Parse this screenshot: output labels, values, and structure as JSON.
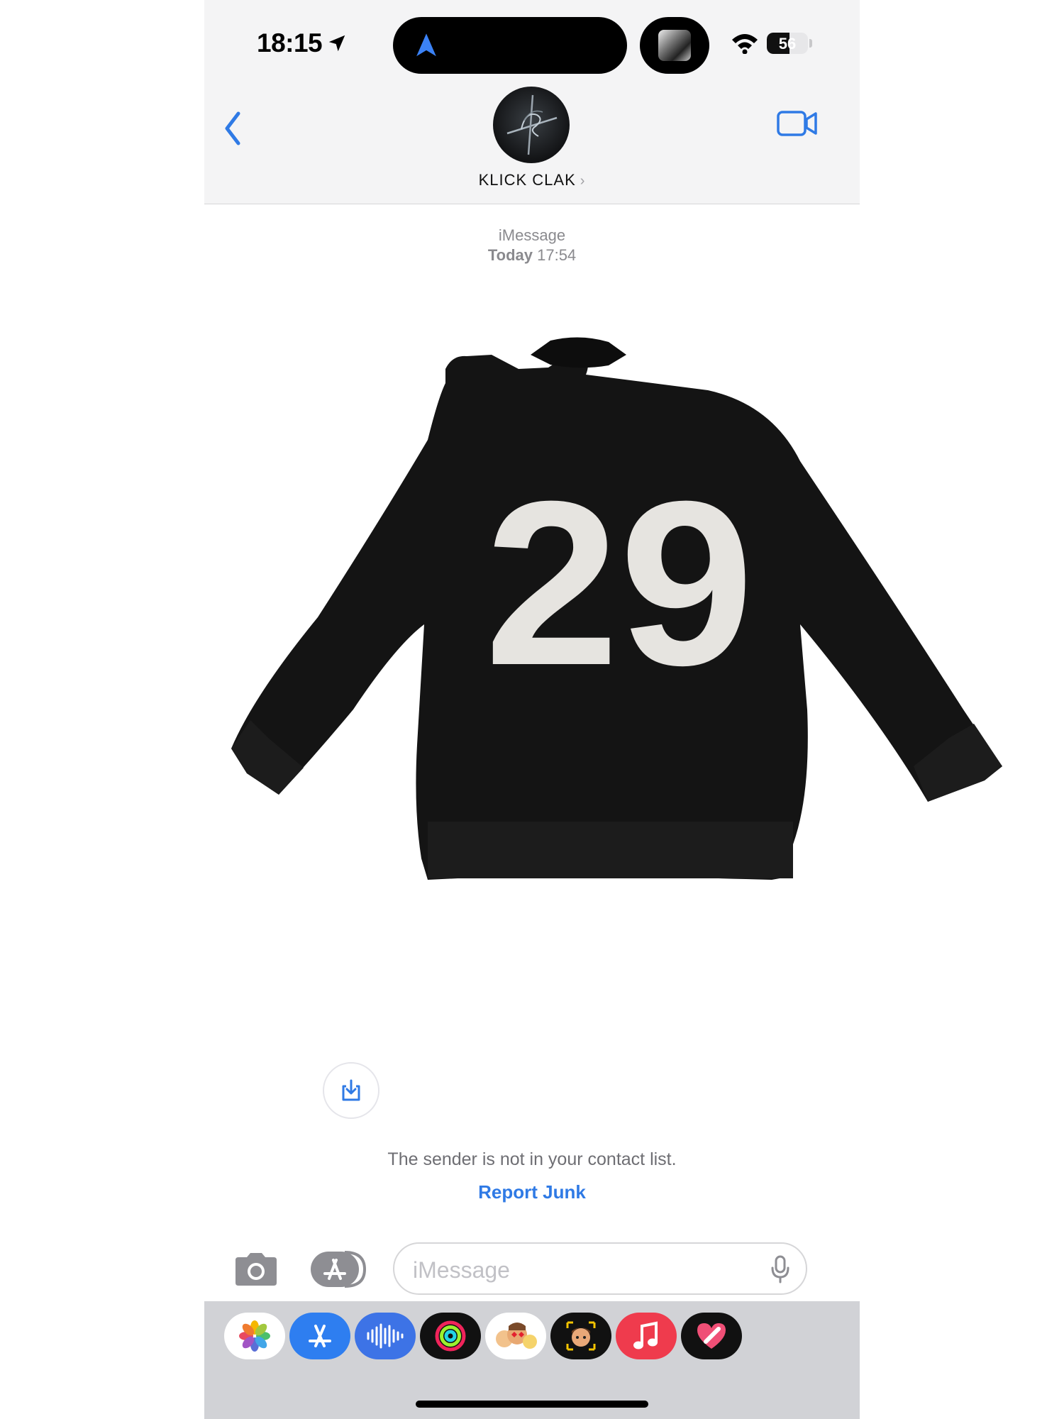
{
  "status_bar": {
    "time": "18:15",
    "battery_level": 56,
    "battery_label": "56"
  },
  "header": {
    "contact_name": "KLICK CLAK",
    "chevron": "›"
  },
  "conversation": {
    "service": "iMessage",
    "timestamp_day": "Today",
    "timestamp_time": "17:54",
    "photo_caption_number": "29",
    "notice": "The sender is not in your contact list.",
    "report_junk": "Report Junk"
  },
  "input": {
    "placeholder": "iMessage"
  },
  "app_drawer": {
    "items": [
      {
        "name": "photos-icon"
      },
      {
        "name": "app-store-icon"
      },
      {
        "name": "audio-message-icon"
      },
      {
        "name": "activity-icon"
      },
      {
        "name": "memoji-stickers-icon"
      },
      {
        "name": "memoji-icon"
      },
      {
        "name": "music-icon"
      },
      {
        "name": "digital-touch-icon"
      }
    ]
  },
  "colors": {
    "accent": "#2f7ae5",
    "header_bg": "#f4f4f5",
    "drawer_bg": "#d1d2d6",
    "secondary_text": "#8a8a8e"
  }
}
